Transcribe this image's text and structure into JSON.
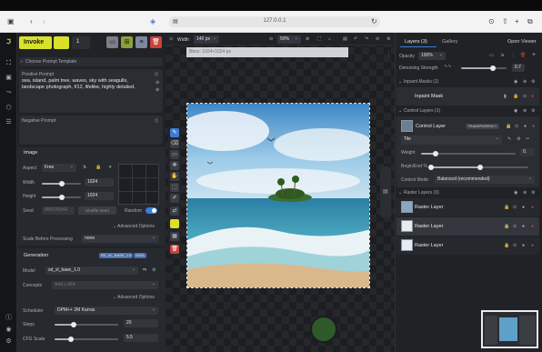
{
  "browser": {
    "url": "127.0.0.1"
  },
  "toolbar": {
    "invoke_label": "Invoke",
    "queue_count": "1",
    "width_label": "Width",
    "width_value": "140 px",
    "zoom_value": "50%"
  },
  "prompt": {
    "template_label": "Choose Prompt Template",
    "positive_label": "Positive Prompt",
    "positive_text": "sea, island, palm tree, waves, sky with seagulls, landscape photograph, f/12, lifelike,  highly detailed.",
    "negative_label": "Negative Prompt"
  },
  "image": {
    "section_label": "Image",
    "aspect_label": "Aspect",
    "aspect_value": "Free",
    "width_label": "Width",
    "width_value": "1024",
    "width_fraction": 0.5,
    "height_label": "Height",
    "height_value": "1024",
    "height_fraction": 0.5,
    "seed_label": "Seed",
    "seed_value": "885435044",
    "shuffle_label": "Shuffle Seed",
    "random_label": "Random",
    "advanced_label": "Advanced Options",
    "scale_before_label": "Scale Before Processing",
    "scale_before_value": "none"
  },
  "generation": {
    "section_label": "Generation",
    "badge_model": "SD_XL_BASE_1.0",
    "badge_type": "SDXL",
    "model_label": "Model",
    "model_value": "sd_xl_base_1.0",
    "concepts_label": "Concepts",
    "concepts_placeholder": "Add LoRA",
    "advanced_label": "Advanced Options",
    "scheduler_label": "Scheduler",
    "scheduler_value": "DPM++ 2M Karras",
    "steps_label": "Steps",
    "steps_value": "20",
    "steps_fraction": 0.3,
    "cfg_label": "CFG Scale",
    "cfg_value": "5.5",
    "cfg_fraction": 0.25
  },
  "canvas": {
    "bbox_label": "Bbox: 1024×1024 px"
  },
  "right": {
    "tab_layers": "Layers (3)",
    "tab_gallery": "Gallery",
    "open_viewer": "Open Viewer",
    "opacity_label": "Opacity",
    "opacity_value": "100%",
    "denoise_label": "Denoising Strength",
    "denoise_value": "0.7",
    "denoise_fraction": 0.7,
    "inpaint_header": "Inpaint Masks (1)",
    "inpaint_mask": "Inpaint Mask",
    "control_header": "Control Layers (1)",
    "control_layer": "Control Layer",
    "transparency_badge": "TRANSPARENCY",
    "control_model": "Tile",
    "weight_label": "Weight",
    "weight_value": "0.",
    "weight_fraction": 0.15,
    "begin_end_label": "Begin/End %",
    "begin_end_value": [
      0,
      0.5
    ],
    "control_mode_label": "Control Mode",
    "control_mode_value": "Balanced (recommended)",
    "raster_header": "Raster Layers (3)",
    "raster_layers": [
      "Raster Layer",
      "Raster Layer",
      "Raster Layer"
    ]
  },
  "colors": {
    "invoke": "#d8e22a",
    "accent_blue": "#3b7dd8",
    "delete_red": "#c9423a"
  }
}
